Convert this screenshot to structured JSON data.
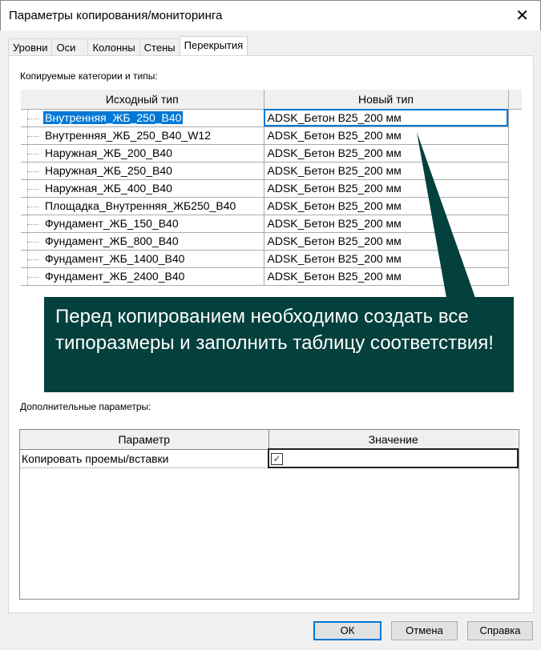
{
  "window": {
    "title": "Параметры копирования/мониторинга",
    "close": "✕"
  },
  "tabs": [
    {
      "label": "Уровни"
    },
    {
      "label": "Оси"
    },
    {
      "label": "Колонны"
    },
    {
      "label": "Стены"
    },
    {
      "label": "Перекрытия",
      "active": true
    }
  ],
  "section1": {
    "label": "Копируемые категории и типы:",
    "columns": [
      "Исходный тип",
      "Новый тип"
    ],
    "rows": [
      [
        "Внутренняя_ЖБ_250_В40",
        "ADSK_Бетон В25_200 мм"
      ],
      [
        "Внутренняя_ЖБ_250_В40_W12",
        "ADSK_Бетон В25_200 мм"
      ],
      [
        "Наружная_ЖБ_200_В40",
        "ADSK_Бетон В25_200 мм"
      ],
      [
        "Наружная_ЖБ_250_В40",
        "ADSK_Бетон В25_200 мм"
      ],
      [
        "Наружная_ЖБ_400_В40",
        "ADSK_Бетон В25_200 мм"
      ],
      [
        "Площадка_Внутренняя_ЖБ250_В40",
        "ADSK_Бетон В25_200 мм"
      ],
      [
        "Фундамент_ЖБ_150_В40",
        "ADSK_Бетон В25_200 мм"
      ],
      [
        "Фундамент_ЖБ_800_В40",
        "ADSK_Бетон В25_200 мм"
      ],
      [
        "Фундамент_ЖБ_1400_В40",
        "ADSK_Бетон В25_200 мм"
      ],
      [
        "Фундамент_ЖБ_2400_В40",
        "ADSK_Бетон В25_200 мм"
      ]
    ]
  },
  "section2": {
    "label": "Дополнительные параметры:",
    "columns": [
      "Параметр",
      "Значение"
    ],
    "rows": [
      {
        "param": "Копировать проемы/вставки",
        "checked": true,
        "mark": "✓"
      }
    ]
  },
  "callout": {
    "text": "Перед копированием необходимо создать все типоразмеры и заполнить таблицу соответствия!",
    "color": "#04403d"
  },
  "buttons": {
    "ok": "ОК",
    "cancel": "Отмена",
    "help": "Справка"
  }
}
